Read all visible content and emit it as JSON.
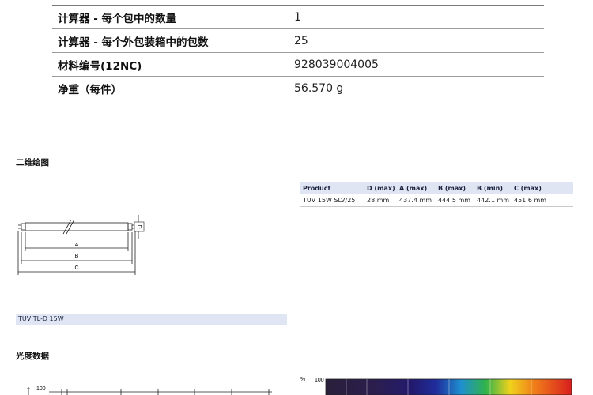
{
  "spec_rows": [
    {
      "label": "计算器 - 每个包中的数量",
      "value": "1"
    },
    {
      "label": "计算器 - 每个外包装箱中的包数",
      "value": "25"
    },
    {
      "label": "材料编号(12NC)",
      "value": "928039004005"
    },
    {
      "label": "净重（每件）",
      "value": "56.570 g"
    }
  ],
  "drawing_section": {
    "title": "二维绘图",
    "dim_labels": {
      "d": "D",
      "a": "A",
      "b": "B",
      "c": "C"
    },
    "caption": "TUV TL-D 15W"
  },
  "dimension_table": {
    "headers": [
      "Product",
      "D (max)",
      "A (max)",
      "B (max)",
      "B (min)",
      "C (max)"
    ],
    "rows": [
      [
        "TUV 15W SLV/25",
        "28 mm",
        "437.4 mm",
        "444.5 mm",
        "442.1 mm",
        "451.6 mm"
      ]
    ]
  },
  "photometric_section": {
    "title": "光度数据",
    "left_axis_top": "100",
    "right_axis_unit": "%",
    "right_axis_top": "100"
  },
  "colors": {
    "accent_bar": "#dfe5f2",
    "spectrum": [
      "#2a1f3a",
      "#2b1e4e",
      "#231a6e",
      "#1f2d9c",
      "#1f8fd0",
      "#2fb34b",
      "#f0d21c",
      "#f07d1a",
      "#d81e1e"
    ]
  }
}
